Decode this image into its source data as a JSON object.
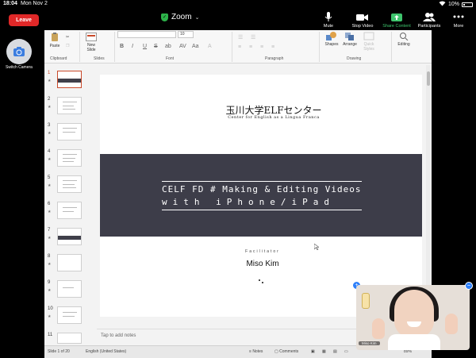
{
  "status_bar": {
    "time": "18:04",
    "date": "Mon Nov 2",
    "battery": "10%"
  },
  "zoom": {
    "leave_label": "Leave",
    "title": "Zoom",
    "toolbar": [
      {
        "label": "Mute",
        "icon": "microphone-icon"
      },
      {
        "label": "Stop Video",
        "icon": "video-camera-icon"
      },
      {
        "label": "Share Content",
        "icon": "share-screen-icon"
      },
      {
        "label": "Participants",
        "icon": "participants-icon"
      },
      {
        "label": "More",
        "icon": "more-icon"
      }
    ],
    "switch_camera_label": "Switch Camera",
    "video_name": "Miso Kim"
  },
  "ribbon": {
    "paste": "Paste",
    "new_slide": "New Slide",
    "shapes": "Shapes",
    "arrange": "Arrange",
    "quick_styles": "Quick Styles",
    "editing": "Editing",
    "font_size": "10",
    "groups": {
      "clipboard": "Clipboard",
      "slides": "Slides",
      "font": "Font",
      "paragraph": "Paragraph",
      "drawing": "Drawing"
    },
    "format_buttons": [
      "B",
      "I",
      "U",
      "S",
      "ab",
      "AV",
      "Aa"
    ]
  },
  "thumbnails": [
    {
      "num": "1"
    },
    {
      "num": "2"
    },
    {
      "num": "3"
    },
    {
      "num": "4"
    },
    {
      "num": "5"
    },
    {
      "num": "6"
    },
    {
      "num": "7"
    },
    {
      "num": "8"
    },
    {
      "num": "9"
    },
    {
      "num": "10"
    },
    {
      "num": "11"
    }
  ],
  "slide": {
    "title_jp": "玉川大学ELFセンター",
    "title_en": "Center for English as a Lingua Franca",
    "line1": "CELF FD # Making & Editing Videos",
    "line2": "with iPhone/iPad",
    "facilitator_label": "Facilitator",
    "presenter": "Miso Kim"
  },
  "notes_placeholder": "Tap to add notes",
  "bottom_bar": {
    "slide_count": "Slide 1 of 20",
    "language": "English (United States)",
    "notes": "Notes",
    "comments": "Comments",
    "zoom_level": "89%"
  }
}
